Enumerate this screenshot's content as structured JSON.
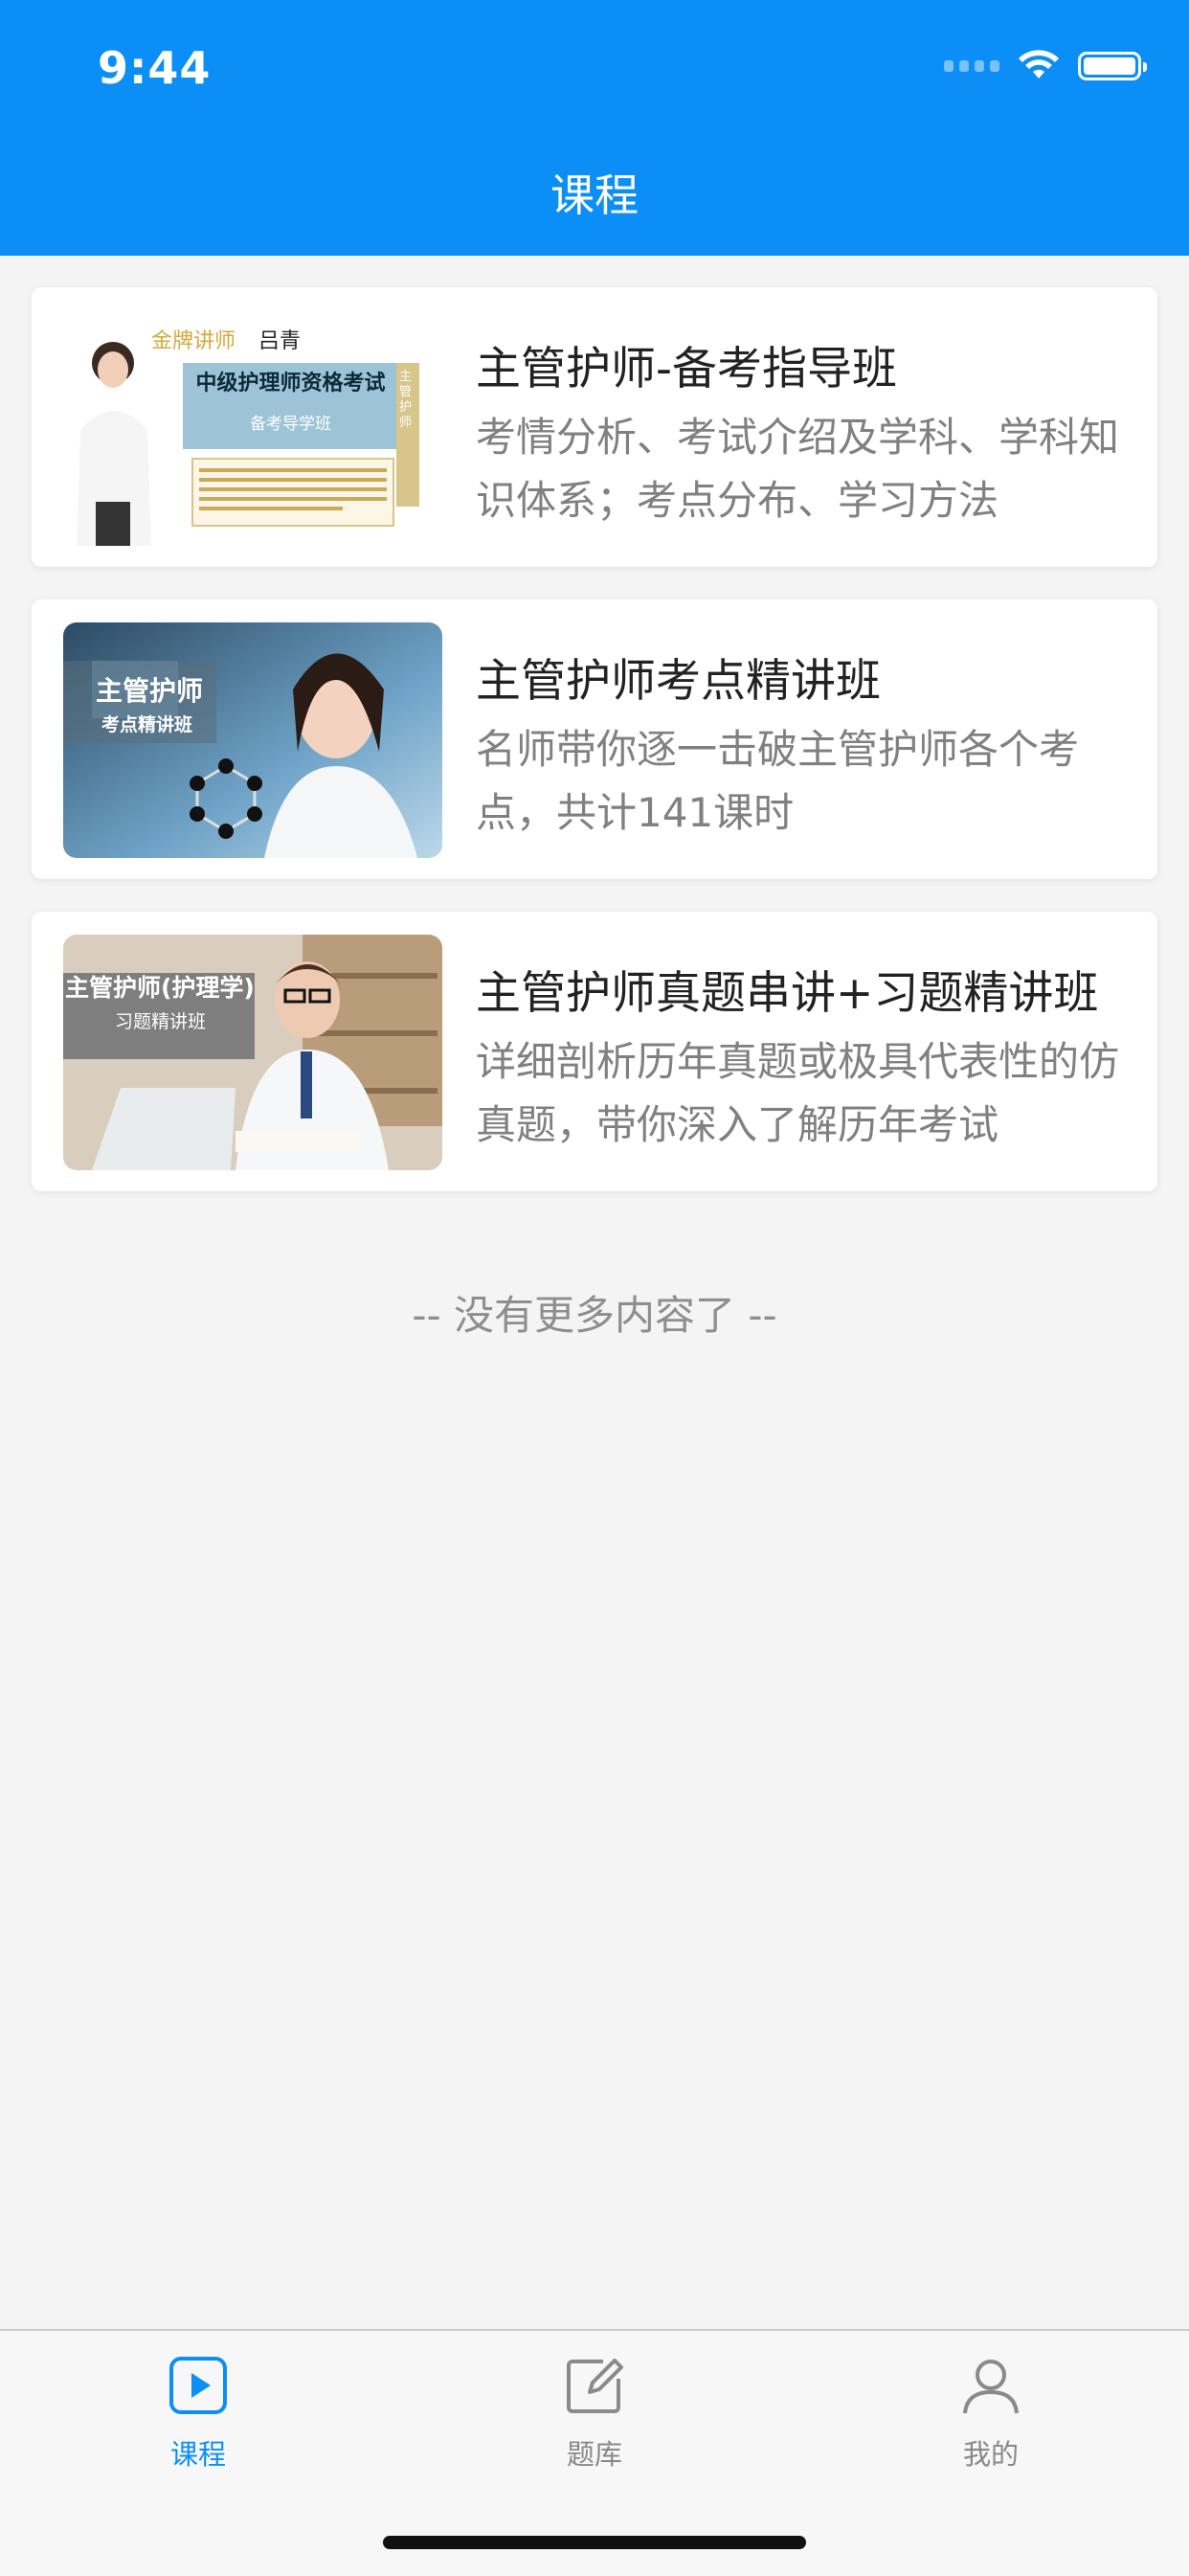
{
  "status_bar": {
    "time": "9:44"
  },
  "nav": {
    "title": "课程"
  },
  "courses": [
    {
      "title": "主管护师-备考指导班",
      "desc": "考情分析、考试介绍及学科、学科知识体系；考点分布、学习方法",
      "thumb": {
        "teacher_role": "金牌讲师",
        "teacher_name": "吕青",
        "banner": "中级护理师资格考试",
        "sub": "备考导学班",
        "side_tag": "主管护师"
      }
    },
    {
      "title": "主管护师考点精讲班",
      "desc": "名师带你逐一击破主管护师各个考点，共计141课时",
      "thumb": {
        "line1": "主管护师",
        "line2": "考点精讲班"
      }
    },
    {
      "title": "主管护师真题串讲+习题精讲班",
      "desc": "详细剖析历年真题或极具代表性的仿真题，带你深入了解历年考试",
      "thumb": {
        "line1": "主管护师(护理学)",
        "line2": "习题精讲班"
      }
    }
  ],
  "footer_text": "-- 没有更多内容了 --",
  "tabbar": {
    "tabs": [
      {
        "label": "课程",
        "icon": "play-square-icon",
        "active": true
      },
      {
        "label": "题库",
        "icon": "edit-square-icon",
        "active": false
      },
      {
        "label": "我的",
        "icon": "person-icon",
        "active": false
      }
    ]
  },
  "colors": {
    "primary": "#0b8ff7",
    "background": "#f4f4f4"
  }
}
